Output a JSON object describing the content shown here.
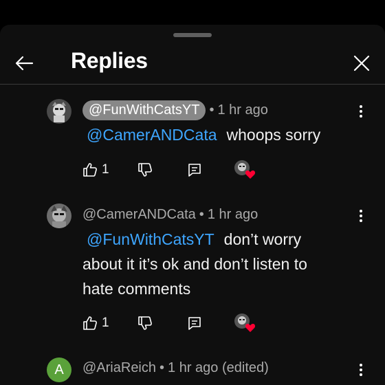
{
  "header": {
    "title": "Replies",
    "back_icon": "arrow-left-icon",
    "close_icon": "close-icon"
  },
  "comments": [
    {
      "author": "@FunWithCatsYT",
      "time": "1 hr ago",
      "mention": "@CamerANDCata",
      "text": "whoops sorry",
      "likes": "1",
      "highlighted_author": true
    },
    {
      "author": "@CamerANDCata",
      "time": "1 hr ago",
      "mention": "@FunWithCatsYT",
      "text": "don’t worry",
      "text_line2": "about it it’s ok and don’t listen to",
      "text_line3": "hate comments",
      "likes": "1"
    },
    {
      "author": "@AriaReich",
      "time": "1 hr ago (edited)",
      "avatar_letter": "A",
      "avatar_color": "#5aa13a"
    }
  ],
  "colors": {
    "background": "#0f0f0f",
    "mention": "#3ea6ff",
    "heart": "#ff0033",
    "meta": "#aaaaaa"
  },
  "dot": "•"
}
